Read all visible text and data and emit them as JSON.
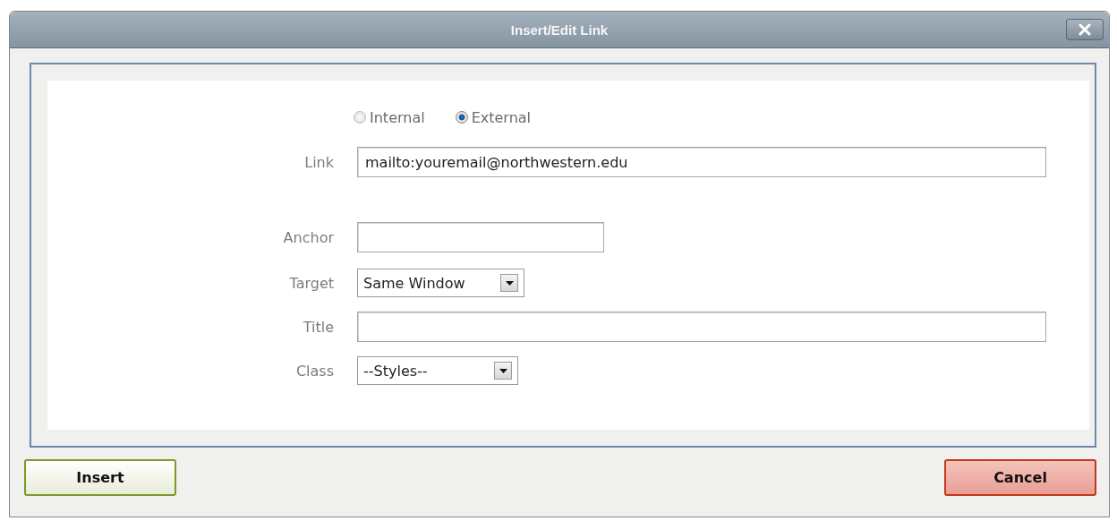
{
  "window": {
    "title": "Insert/Edit Link"
  },
  "link_type": [
    {
      "label": "Internal",
      "selected": false
    },
    {
      "label": "External",
      "selected": true
    }
  ],
  "fields": [
    {
      "kind": "text",
      "label": "Link",
      "value": "mailto:youremail@northwestern.edu"
    },
    {
      "kind": "text",
      "label": "Anchor"
    },
    {
      "kind": "select",
      "label": "Target",
      "value": "Same Window"
    },
    {
      "kind": "text",
      "label": "Title"
    },
    {
      "kind": "select",
      "label": "Class",
      "value": "--Styles--"
    }
  ],
  "buttons": [
    {
      "kind": "confirm",
      "label": "Insert"
    },
    {
      "kind": "cancel",
      "label": "Cancel"
    }
  ]
}
